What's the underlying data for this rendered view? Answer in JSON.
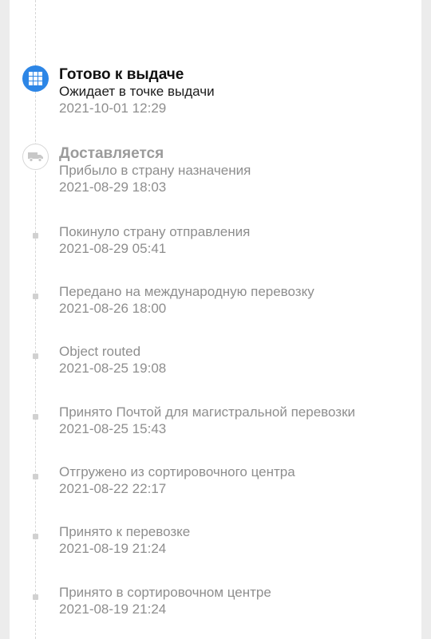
{
  "events": [
    {
      "title": "Готово к выдаче",
      "description": "Ожидает в точке выдачи",
      "datetime": "2021-10-01 12:29",
      "icon": "grid-icon",
      "status": "current"
    },
    {
      "title": "Доставляется",
      "description": "Прибыло в страну назначения",
      "datetime": "2021-08-29 18:03",
      "icon": "truck-icon",
      "status": "past"
    },
    {
      "description": "Покинуло страну отправления",
      "datetime": "2021-08-29 05:41"
    },
    {
      "description": "Передано на международную перевозку",
      "datetime": "2021-08-26 18:00"
    },
    {
      "description": "Object routed",
      "datetime": "2021-08-25 19:08"
    },
    {
      "description": "Принято Почтой для магистральной перевозки",
      "datetime": "2021-08-25 15:43"
    },
    {
      "description": "Отгружено из сортировочного центра",
      "datetime": "2021-08-22 22:17"
    },
    {
      "description": "Принято к перевозке",
      "datetime": "2021-08-19 21:24"
    },
    {
      "description": "Принято в сортировочном центре",
      "datetime": "2021-08-19 21:24"
    }
  ],
  "colors": {
    "accent": "#2d86e6",
    "text_primary": "#111111",
    "text_secondary": "#8e8e8e",
    "background": "#ececec",
    "card": "#ffffff"
  }
}
